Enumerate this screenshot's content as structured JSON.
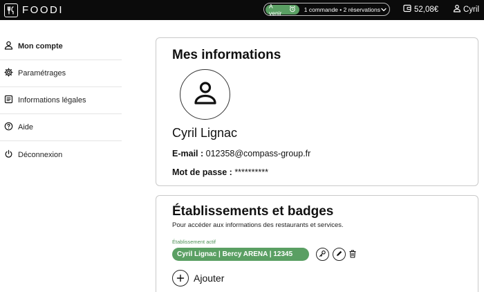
{
  "header": {
    "brand": "FOODI",
    "upcoming_label": "A venir",
    "upcoming_summary": "1 commande • 2 réservations",
    "balance": "52,08€",
    "user_name": "Cyril"
  },
  "sidebar": {
    "items": [
      {
        "label": "Mon compte",
        "icon": "user-icon",
        "active": true
      },
      {
        "label": "Paramétrages",
        "icon": "gear-icon"
      },
      {
        "label": "Informations légales",
        "icon": "document-icon"
      },
      {
        "label": "Aide",
        "icon": "help-icon"
      },
      {
        "label": "Déconnexion",
        "icon": "power-icon"
      }
    ]
  },
  "info_card": {
    "title": "Mes informations",
    "full_name": "Cyril Lignac",
    "email_label": "E-mail :",
    "email_value": "012358@compass-group.fr",
    "password_label": "Mot de passe :",
    "password_value": "**********"
  },
  "estab_card": {
    "title": "Établissements et badges",
    "subtitle": "Pour accéder aux informations des restaurants et services.",
    "active_label": "Établissement actif",
    "badge_text": "Cyril Lignac | Bercy ARENA |  12345",
    "add_label": "Ajouter"
  },
  "colors": {
    "accent_green": "#5a9f63",
    "topbar": "#0b0b0b"
  }
}
